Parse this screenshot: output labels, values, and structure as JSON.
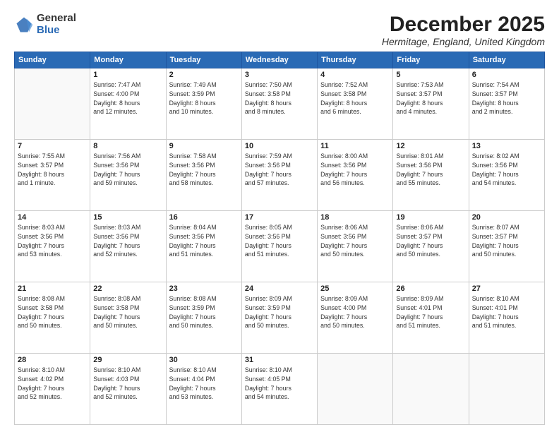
{
  "logo": {
    "general": "General",
    "blue": "Blue"
  },
  "title": "December 2025",
  "location": "Hermitage, England, United Kingdom",
  "days_of_week": [
    "Sunday",
    "Monday",
    "Tuesday",
    "Wednesday",
    "Thursday",
    "Friday",
    "Saturday"
  ],
  "weeks": [
    [
      {
        "num": "",
        "info": ""
      },
      {
        "num": "1",
        "info": "Sunrise: 7:47 AM\nSunset: 4:00 PM\nDaylight: 8 hours\nand 12 minutes."
      },
      {
        "num": "2",
        "info": "Sunrise: 7:49 AM\nSunset: 3:59 PM\nDaylight: 8 hours\nand 10 minutes."
      },
      {
        "num": "3",
        "info": "Sunrise: 7:50 AM\nSunset: 3:58 PM\nDaylight: 8 hours\nand 8 minutes."
      },
      {
        "num": "4",
        "info": "Sunrise: 7:52 AM\nSunset: 3:58 PM\nDaylight: 8 hours\nand 6 minutes."
      },
      {
        "num": "5",
        "info": "Sunrise: 7:53 AM\nSunset: 3:57 PM\nDaylight: 8 hours\nand 4 minutes."
      },
      {
        "num": "6",
        "info": "Sunrise: 7:54 AM\nSunset: 3:57 PM\nDaylight: 8 hours\nand 2 minutes."
      }
    ],
    [
      {
        "num": "7",
        "info": "Sunrise: 7:55 AM\nSunset: 3:57 PM\nDaylight: 8 hours\nand 1 minute."
      },
      {
        "num": "8",
        "info": "Sunrise: 7:56 AM\nSunset: 3:56 PM\nDaylight: 7 hours\nand 59 minutes."
      },
      {
        "num": "9",
        "info": "Sunrise: 7:58 AM\nSunset: 3:56 PM\nDaylight: 7 hours\nand 58 minutes."
      },
      {
        "num": "10",
        "info": "Sunrise: 7:59 AM\nSunset: 3:56 PM\nDaylight: 7 hours\nand 57 minutes."
      },
      {
        "num": "11",
        "info": "Sunrise: 8:00 AM\nSunset: 3:56 PM\nDaylight: 7 hours\nand 56 minutes."
      },
      {
        "num": "12",
        "info": "Sunrise: 8:01 AM\nSunset: 3:56 PM\nDaylight: 7 hours\nand 55 minutes."
      },
      {
        "num": "13",
        "info": "Sunrise: 8:02 AM\nSunset: 3:56 PM\nDaylight: 7 hours\nand 54 minutes."
      }
    ],
    [
      {
        "num": "14",
        "info": "Sunrise: 8:03 AM\nSunset: 3:56 PM\nDaylight: 7 hours\nand 53 minutes."
      },
      {
        "num": "15",
        "info": "Sunrise: 8:03 AM\nSunset: 3:56 PM\nDaylight: 7 hours\nand 52 minutes."
      },
      {
        "num": "16",
        "info": "Sunrise: 8:04 AM\nSunset: 3:56 PM\nDaylight: 7 hours\nand 51 minutes."
      },
      {
        "num": "17",
        "info": "Sunrise: 8:05 AM\nSunset: 3:56 PM\nDaylight: 7 hours\nand 51 minutes."
      },
      {
        "num": "18",
        "info": "Sunrise: 8:06 AM\nSunset: 3:56 PM\nDaylight: 7 hours\nand 50 minutes."
      },
      {
        "num": "19",
        "info": "Sunrise: 8:06 AM\nSunset: 3:57 PM\nDaylight: 7 hours\nand 50 minutes."
      },
      {
        "num": "20",
        "info": "Sunrise: 8:07 AM\nSunset: 3:57 PM\nDaylight: 7 hours\nand 50 minutes."
      }
    ],
    [
      {
        "num": "21",
        "info": "Sunrise: 8:08 AM\nSunset: 3:58 PM\nDaylight: 7 hours\nand 50 minutes."
      },
      {
        "num": "22",
        "info": "Sunrise: 8:08 AM\nSunset: 3:58 PM\nDaylight: 7 hours\nand 50 minutes."
      },
      {
        "num": "23",
        "info": "Sunrise: 8:08 AM\nSunset: 3:59 PM\nDaylight: 7 hours\nand 50 minutes."
      },
      {
        "num": "24",
        "info": "Sunrise: 8:09 AM\nSunset: 3:59 PM\nDaylight: 7 hours\nand 50 minutes."
      },
      {
        "num": "25",
        "info": "Sunrise: 8:09 AM\nSunset: 4:00 PM\nDaylight: 7 hours\nand 50 minutes."
      },
      {
        "num": "26",
        "info": "Sunrise: 8:09 AM\nSunset: 4:01 PM\nDaylight: 7 hours\nand 51 minutes."
      },
      {
        "num": "27",
        "info": "Sunrise: 8:10 AM\nSunset: 4:01 PM\nDaylight: 7 hours\nand 51 minutes."
      }
    ],
    [
      {
        "num": "28",
        "info": "Sunrise: 8:10 AM\nSunset: 4:02 PM\nDaylight: 7 hours\nand 52 minutes."
      },
      {
        "num": "29",
        "info": "Sunrise: 8:10 AM\nSunset: 4:03 PM\nDaylight: 7 hours\nand 52 minutes."
      },
      {
        "num": "30",
        "info": "Sunrise: 8:10 AM\nSunset: 4:04 PM\nDaylight: 7 hours\nand 53 minutes."
      },
      {
        "num": "31",
        "info": "Sunrise: 8:10 AM\nSunset: 4:05 PM\nDaylight: 7 hours\nand 54 minutes."
      },
      {
        "num": "",
        "info": ""
      },
      {
        "num": "",
        "info": ""
      },
      {
        "num": "",
        "info": ""
      }
    ]
  ]
}
